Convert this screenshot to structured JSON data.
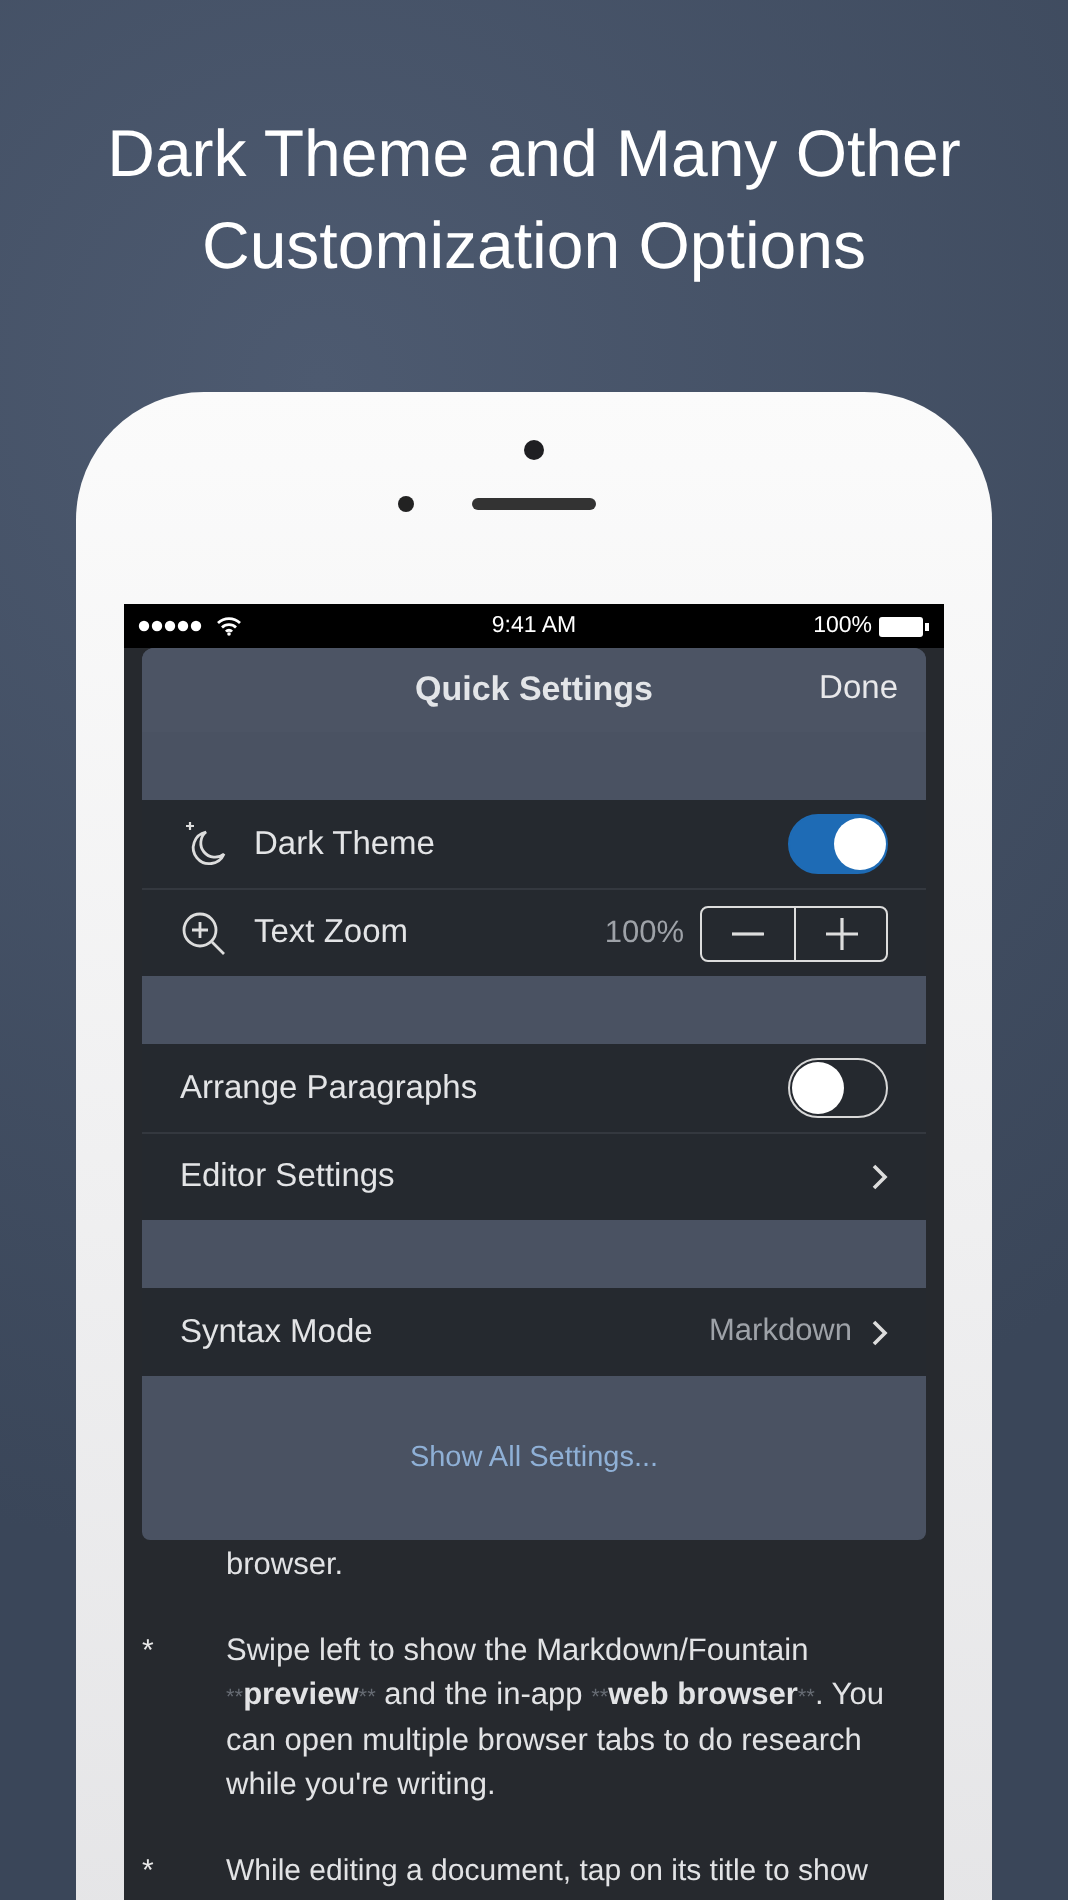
{
  "headline_lines": [
    "Dark Theme and Many Other",
    "Customization Options"
  ],
  "status_bar": {
    "time": "9:41 AM",
    "battery": "100%"
  },
  "sheet": {
    "title": "Quick Settings",
    "done": "Done",
    "groups": [
      {
        "rows": [
          {
            "kind": "toggle",
            "label": "Dark Theme",
            "on": true
          },
          {
            "kind": "zoom",
            "label": "Text Zoom",
            "value": "100%"
          }
        ]
      },
      {
        "rows": [
          {
            "kind": "toggle",
            "label": "Arrange Paragraphs",
            "on": false
          },
          {
            "kind": "link",
            "label": "Editor Settings"
          }
        ]
      },
      {
        "rows": [
          {
            "kind": "link",
            "label": "Syntax Mode",
            "value": "Markdown"
          }
        ]
      }
    ],
    "footer_link": "Show All Settings..."
  },
  "editor": {
    "paragraphs": [
      {
        "segments": [
          {
            "kind": "plain",
            "text": "browser."
          }
        ]
      },
      {
        "bullet": "*",
        "segments": [
          {
            "kind": "plain",
            "text": "Swipe left to show the Markdown/Fountain "
          },
          {
            "kind": "marker",
            "text": "**"
          },
          {
            "kind": "bold",
            "text": "preview"
          },
          {
            "kind": "marker",
            "text": "**"
          },
          {
            "kind": "plain",
            "text": " and the in-app "
          },
          {
            "kind": "marker",
            "text": "**"
          },
          {
            "kind": "bold",
            "text": "web browser"
          },
          {
            "kind": "marker",
            "text": "**"
          },
          {
            "kind": "plain",
            "text": ". You can open multiple browser tabs to do research while you're writing."
          }
        ]
      },
      {
        "bullet": "*",
        "segments": [
          {
            "kind": "plain",
            "text": "While editing a document, tap on its title to show"
          }
        ]
      }
    ]
  }
}
